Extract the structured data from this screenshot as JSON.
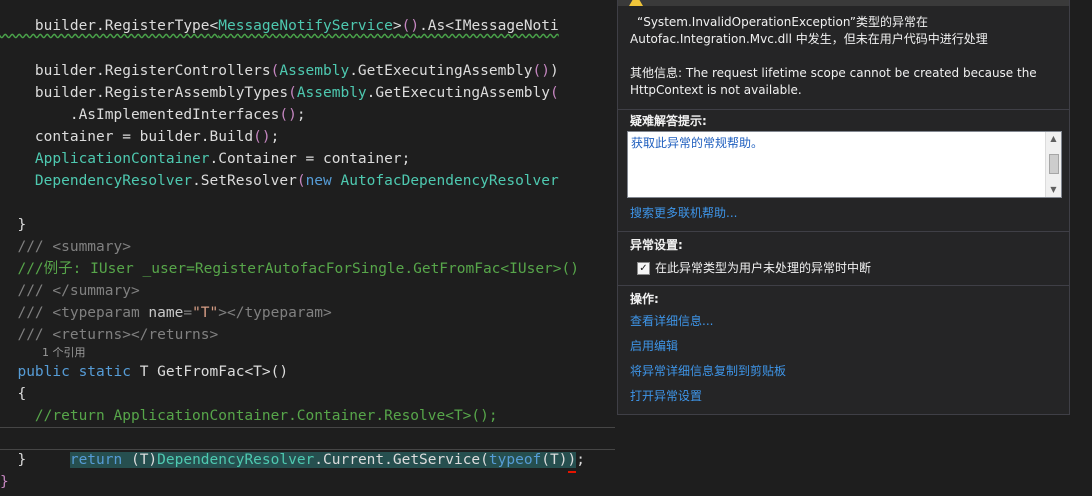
{
  "editor": {
    "lines": [
      {
        "id": "l1",
        "parts": [
          [
            "plain",
            "    builder.RegisterType"
          ],
          [
            "brkt",
            "<"
          ],
          [
            "type",
            "MessageNotifyService"
          ],
          [
            "brkt",
            ">"
          ],
          [
            "paren",
            "()"
          ],
          [
            "plain",
            ".As<IMessageNoti"
          ]
        ]
      },
      {
        "id": "l2",
        "parts": [
          [
            "plain",
            "    builder.RegisterControllers"
          ],
          [
            "paren",
            "("
          ],
          [
            "type",
            "Assembly"
          ],
          [
            "plain",
            ".GetExecutingAssembly"
          ],
          [
            "paren",
            "()"
          ],
          [
            "plain",
            ")"
          ]
        ]
      },
      {
        "id": "l3",
        "parts": [
          [
            "plain",
            "    builder.RegisterAssemblyTypes"
          ],
          [
            "paren",
            "("
          ],
          [
            "type",
            "Assembly"
          ],
          [
            "plain",
            ".GetExecutingAssembly"
          ],
          [
            "paren",
            "("
          ]
        ]
      },
      {
        "id": "l4",
        "parts": [
          [
            "plain",
            "        .AsImplementedInterfaces"
          ],
          [
            "paren",
            "()"
          ],
          [
            "plain",
            ";"
          ]
        ]
      },
      {
        "id": "l5",
        "parts": [
          [
            "plain",
            "    container = builder.Build"
          ],
          [
            "paren",
            "()"
          ],
          [
            "plain",
            ";"
          ]
        ]
      },
      {
        "id": "l6",
        "parts": [
          [
            "plain",
            "    "
          ],
          [
            "type",
            "ApplicationContainer"
          ],
          [
            "plain",
            ".Container = container;"
          ]
        ]
      },
      {
        "id": "l7",
        "parts": [
          [
            "plain",
            "    "
          ],
          [
            "type",
            "DependencyResolver"
          ],
          [
            "plain",
            ".SetResolver"
          ],
          [
            "paren",
            "("
          ],
          [
            "kw",
            "new "
          ],
          [
            "type",
            "AutofacDependencyResolver"
          ]
        ]
      },
      {
        "id": "l8",
        "parts": [
          [
            "plain",
            "  }"
          ]
        ]
      },
      {
        "id": "l9",
        "parts": [
          [
            "xmltag",
            "  /// <summary>"
          ]
        ]
      },
      {
        "id": "l10",
        "parts": [
          [
            "cmt",
            "  ///例子: IUser _user=RegisterAutofacForSingle.GetFromFac<IUser>()"
          ]
        ]
      },
      {
        "id": "l11",
        "parts": [
          [
            "xmltag",
            "  /// </summary>"
          ]
        ]
      },
      {
        "id": "l12",
        "parts": [
          [
            "xmltag",
            "  /// <typeparam "
          ],
          [
            "xmlattr",
            "name"
          ],
          [
            "xmltag",
            "="
          ],
          [
            "xmlstr",
            "\"T\""
          ],
          [
            "xmltag",
            "></typeparam>"
          ]
        ]
      },
      {
        "id": "l13",
        "parts": [
          [
            "xmltag",
            "  /// <returns></returns>"
          ]
        ]
      },
      {
        "id": "l14",
        "parts": [
          [
            "kw",
            "  public static "
          ],
          [
            "plain",
            "T GetFromFac<T>()"
          ]
        ]
      },
      {
        "id": "l15",
        "parts": [
          [
            "plain",
            "  {"
          ]
        ]
      },
      {
        "id": "l16",
        "parts": [
          [
            "cmt",
            "    //return ApplicationContainer.Container.Resolve<T>();"
          ]
        ]
      },
      {
        "id": "l18",
        "parts": [
          [
            "plain",
            "  }"
          ]
        ]
      },
      {
        "id": "l19",
        "parts": [
          [
            "plain",
            "}"
          ]
        ]
      }
    ],
    "codelens": "1 个引用",
    "current_line": {
      "indent": "    ",
      "return_kw": "return",
      "rest_a": " (T)",
      "type_a": "DependencyResolver",
      "rest_b": ".Current.GetService(",
      "typeof_kw": "typeof",
      "rest_c": "(T)",
      "close": ")",
      "semi": ";"
    }
  },
  "popup": {
    "header_line1": "“System.InvalidOperationException”类型的异常在",
    "header_line2": "Autofac.Integration.Mvc.dll 中发生，但未在用户代码中进行处理",
    "info_line1": "其他信息: The request lifetime scope cannot be created because the",
    "info_line2": "HttpContext is not available.",
    "hints_title": "疑难解答提示:",
    "hints_link": "获取此异常的常规帮助。",
    "search_link": "搜索更多联机帮助...",
    "settings_title": "异常设置:",
    "settings_checkbox": "在此异常类型为用户未处理的异常时中断",
    "checkbox_checked": "✓",
    "actions_title": "操作:",
    "actions": [
      "查看详细信息...",
      "启用编辑",
      "将异常详细信息复制到剪贴板",
      "打开异常设置"
    ]
  },
  "colors": {
    "editor_bg": "#1e1e1e",
    "keyword": "#569cd6",
    "type": "#4ec9b0",
    "comment": "#57a64a",
    "link": "#3e95e8",
    "popup_bg": "#252526"
  }
}
